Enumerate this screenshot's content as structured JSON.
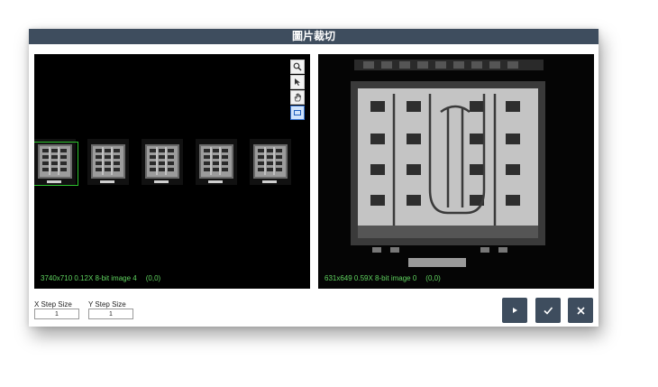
{
  "dialog": {
    "title": "圖片裁切"
  },
  "left_viewer": {
    "status_text": "3740x710 0.12X 8-bit image 4",
    "coord_text": "(0,0)",
    "tools": [
      {
        "name": "zoom-icon"
      },
      {
        "name": "pointer-icon"
      },
      {
        "name": "hand-pan-icon"
      },
      {
        "name": "rectangle-select-icon",
        "active": true
      }
    ]
  },
  "right_viewer": {
    "status_text": "631x649 0.59X 8-bit image 0",
    "coord_text": "(0,0)"
  },
  "step": {
    "x_label": "X Step Size",
    "x_value": "1",
    "y_label": "Y Step Size",
    "y_value": "1"
  },
  "actions": [
    {
      "name": "play-icon"
    },
    {
      "name": "check-icon"
    },
    {
      "name": "close-icon"
    }
  ],
  "colors": {
    "title_bar": "#3e4d5e",
    "status_text": "#5fd35f",
    "selection_border": "#2ec22e",
    "button": "#3e4d5e"
  }
}
